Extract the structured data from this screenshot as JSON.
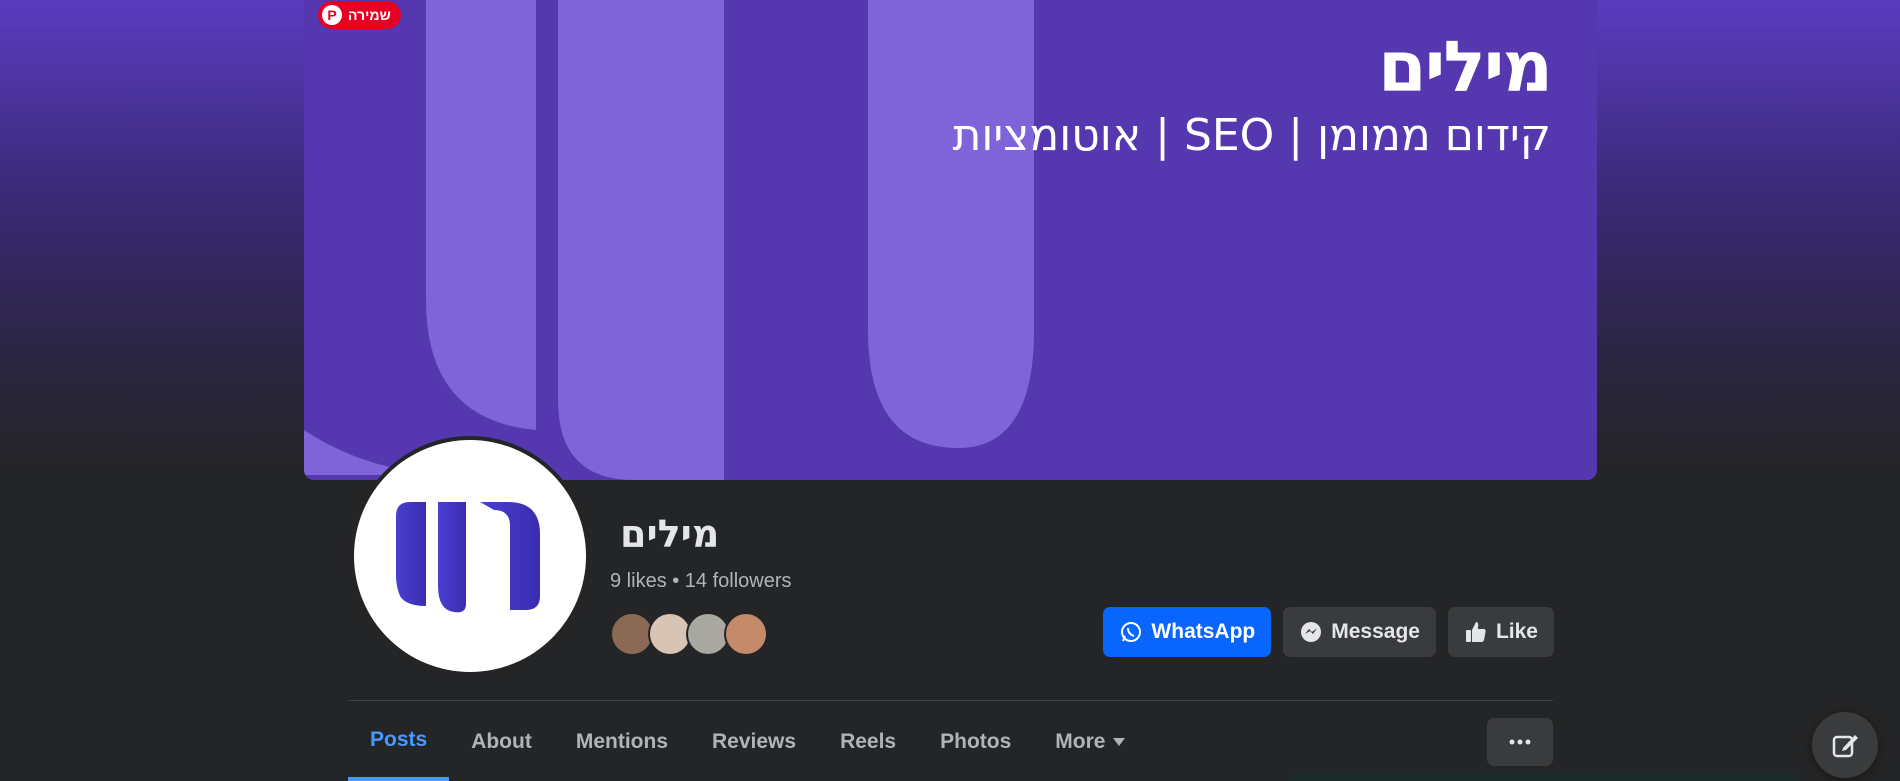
{
  "cover": {
    "title": "מילים",
    "subtitle": "קידום ממומן | SEO | אוטומציות",
    "save_badge": "שמירה",
    "save_icon": "pinterest-icon"
  },
  "profile": {
    "name": "מילים",
    "stats": "9 likes • 14 followers",
    "friend_avatars": [
      "#8a6a55",
      "#d8c4b4",
      "#a8a8a0",
      "#c48a6a"
    ]
  },
  "actions": {
    "whatsapp": "WhatsApp",
    "message": "Message",
    "like": "Like"
  },
  "tabs": [
    {
      "label": "Posts",
      "active": true
    },
    {
      "label": "About"
    },
    {
      "label": "Mentions"
    },
    {
      "label": "Reviews"
    },
    {
      "label": "Reels"
    },
    {
      "label": "Photos"
    },
    {
      "label": "More"
    }
  ],
  "colors": {
    "brand_purple": "#5537b0",
    "accent_blue": "#0866ff",
    "active_tab": "#4599ff"
  }
}
